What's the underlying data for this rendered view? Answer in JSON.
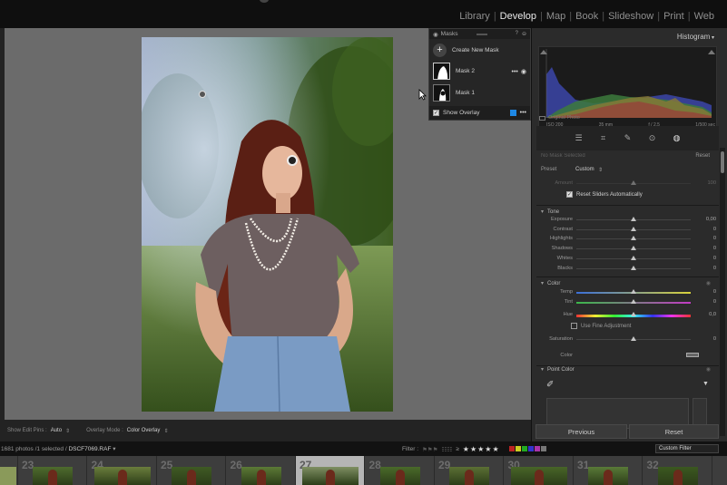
{
  "modules": [
    "Library",
    "Develop",
    "Map",
    "Book",
    "Slideshow",
    "Print",
    "Web"
  ],
  "active_module": "Develop",
  "masks_panel": {
    "title": "Masks",
    "create_label": "Create New Mask",
    "masks": [
      {
        "name": "Mask 2",
        "selected": true
      },
      {
        "name": "Mask 1",
        "selected": false
      }
    ],
    "show_overlay_label": "Show Overlay",
    "overlay_color": "#1e88e5"
  },
  "toolbar": {
    "show_edit_pins_label": "Show Edit Pins :",
    "show_edit_pins_value": "Auto",
    "overlay_mode_label": "Overlay Mode :",
    "overlay_mode_value": "Color Overlay"
  },
  "histogram": {
    "title": "Histogram",
    "iso": "ISO 200",
    "focal": "35 mm",
    "aperture": "f / 2,5",
    "shutter": "1/500 sec",
    "original_photo": "Original Photo"
  },
  "mask_settings": {
    "no_mask": "No Mask Selected",
    "reset": "Reset",
    "preset_label": "Preset",
    "preset_value": "Custom",
    "amount_label": "Amount",
    "amount_value": "100",
    "reset_sliders": "Reset Sliders Automatically"
  },
  "tone": {
    "title": "Tone",
    "sliders": [
      {
        "label": "Exposure",
        "value": "0,00",
        "pos": 0.5
      },
      {
        "label": "Contrast",
        "value": "0",
        "pos": 0.5
      },
      {
        "label": "Highlights",
        "value": "0",
        "pos": 0.5
      },
      {
        "label": "Shadows",
        "value": "0",
        "pos": 0.5
      },
      {
        "label": "Whites",
        "value": "0",
        "pos": 0.5
      },
      {
        "label": "Blacks",
        "value": "0",
        "pos": 0.5
      }
    ]
  },
  "color": {
    "title": "Color",
    "temp_label": "Temp",
    "temp_value": "0",
    "tint_label": "Tint",
    "tint_value": "0",
    "hue_label": "Hue",
    "hue_value": "0,0",
    "fine_adjust_label": "Use Fine Adjustment",
    "saturation_label": "Saturation",
    "saturation_value": "0",
    "color_label": "Color"
  },
  "point_color": {
    "title": "Point Color"
  },
  "buttons": {
    "previous": "Previous",
    "reset": "Reset"
  },
  "filmstrip": {
    "count_text": "1681 photos /1 selected /",
    "filename": "DSCF7069.RAF",
    "filter_label": "Filter :",
    "custom_filter": "Custom Filter",
    "rating_prefix": "≥",
    "stars": "★★★★★",
    "numbers": [
      "23",
      "24",
      "25",
      "26",
      "27",
      "28",
      "29",
      "30",
      "31",
      "32"
    ],
    "selected": "27",
    "label_colors": [
      "#b22",
      "#cc2",
      "#2a2",
      "#33c",
      "#a3a",
      "#777"
    ]
  }
}
